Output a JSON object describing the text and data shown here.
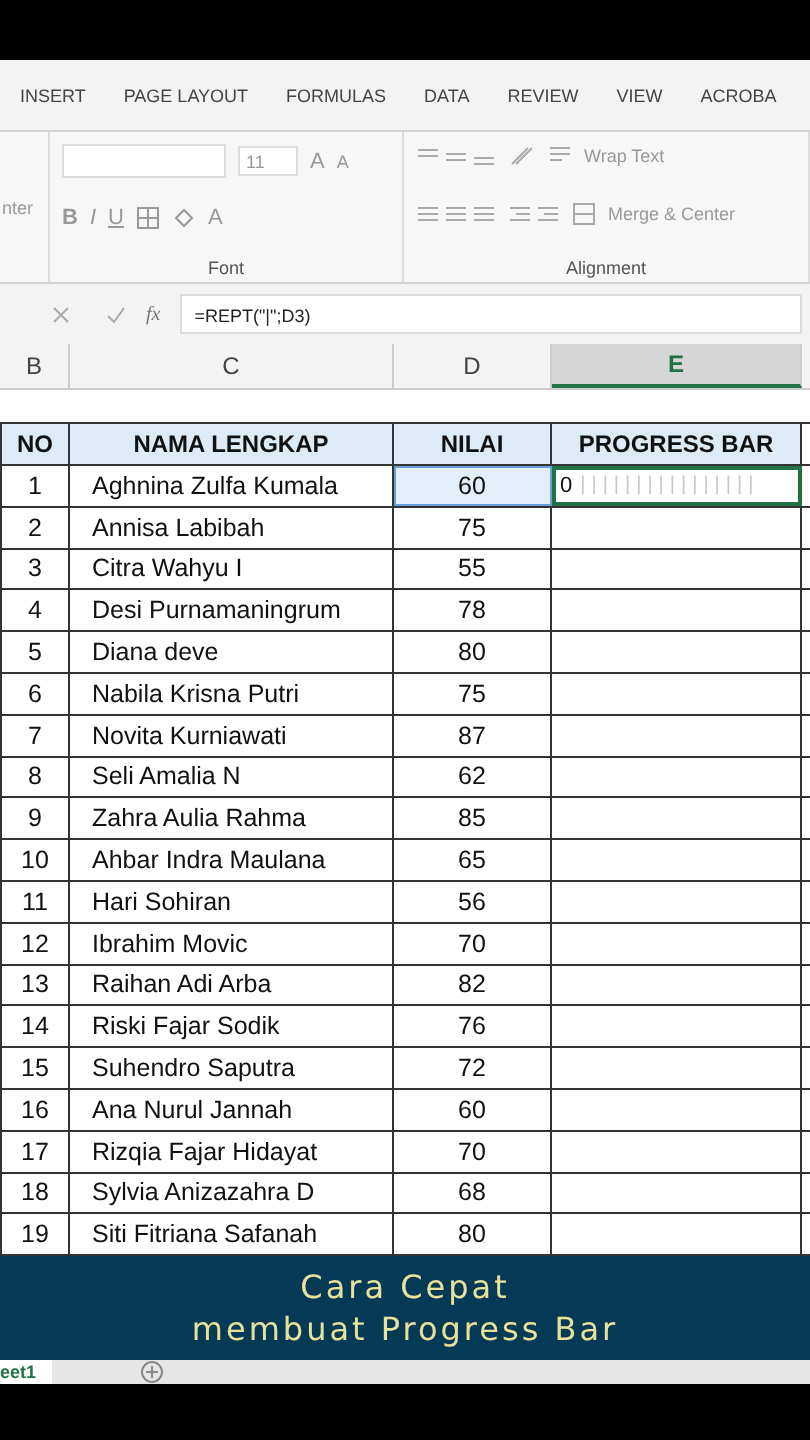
{
  "ribbon_tabs": [
    {
      "label": "INSERT",
      "selected": false
    },
    {
      "label": "PAGE LAYOUT",
      "selected": false
    },
    {
      "label": "FORMULAS",
      "selected": false
    },
    {
      "label": "DATA",
      "selected": false
    },
    {
      "label": "REVIEW",
      "selected": false
    },
    {
      "label": "VIEW",
      "selected": false
    },
    {
      "label": "ACROBA",
      "selected": false
    }
  ],
  "ribbon": {
    "cut_label": "nter",
    "font_size": "11",
    "bold": "B",
    "italic": "I",
    "underline": "U",
    "font_color": "A",
    "grow": "A",
    "shrink": "A",
    "wrap_text": "Wrap Text",
    "merge_center": "Merge & Center",
    "groups": [
      "Font",
      "Alignment"
    ]
  },
  "formula_bar": {
    "fx": "fx",
    "formula": "=REPT(\"|\";D3)"
  },
  "columns": [
    {
      "label": "B",
      "selected": false
    },
    {
      "label": "C",
      "selected": false
    },
    {
      "label": "D",
      "selected": false
    },
    {
      "label": "E",
      "selected": true
    }
  ],
  "table": {
    "headers": [
      "NO",
      "NAMA LENGKAP",
      "NILAI",
      "PROGRESS BAR"
    ],
    "rows": [
      {
        "no": "1",
        "name": "Aghnina Zulfa Kumala",
        "nilai": "60",
        "progress": "0",
        "bar": "||||||||||||||||",
        "selected": true
      },
      {
        "no": "2",
        "name": "Annisa Labibah",
        "nilai": "75",
        "selected": false
      },
      {
        "no": "3",
        "name": "Citra Wahyu I",
        "nilai": "55",
        "selected": false
      },
      {
        "no": "4",
        "name": "Desi Purnamaningrum",
        "nilai": "78",
        "selected": false
      },
      {
        "no": "5",
        "name": "Diana deve",
        "nilai": "80",
        "selected": false
      },
      {
        "no": "6",
        "name": "Nabila Krisna Putri",
        "nilai": "75",
        "selected": false
      },
      {
        "no": "7",
        "name": "Novita Kurniawati",
        "nilai": "87",
        "selected": false
      },
      {
        "no": "8",
        "name": "Seli Amalia N",
        "nilai": "62",
        "selected": false
      },
      {
        "no": "9",
        "name": "Zahra Aulia Rahma",
        "nilai": "85",
        "selected": false
      },
      {
        "no": "10",
        "name": "Ahbar Indra Maulana",
        "nilai": "65",
        "selected": false
      },
      {
        "no": "11",
        "name": "Hari Sohiran",
        "nilai": "56",
        "selected": false
      },
      {
        "no": "12",
        "name": "Ibrahim Movic",
        "nilai": "70",
        "selected": false
      },
      {
        "no": "13",
        "name": "Raihan Adi Arba",
        "nilai": "82",
        "selected": false
      },
      {
        "no": "14",
        "name": "Riski Fajar Sodik",
        "nilai": "76",
        "selected": false
      },
      {
        "no": "15",
        "name": "Suhendro Saputra",
        "nilai": "72",
        "selected": false
      },
      {
        "no": "16",
        "name": "Ana Nurul Jannah",
        "nilai": "60",
        "selected": false
      },
      {
        "no": "17",
        "name": "Rizqia Fajar Hidayat",
        "nilai": "70",
        "selected": false
      },
      {
        "no": "18",
        "name": "Sylvia Anizazahra D",
        "nilai": "68",
        "selected": false
      },
      {
        "no": "19",
        "name": "Siti Fitriana Safanah",
        "nilai": "80",
        "selected": false
      }
    ]
  },
  "banner": {
    "lines": [
      "Cara Cepat",
      "membuat Progress Bar"
    ]
  },
  "sheet_tab": {
    "label": "eet1"
  }
}
